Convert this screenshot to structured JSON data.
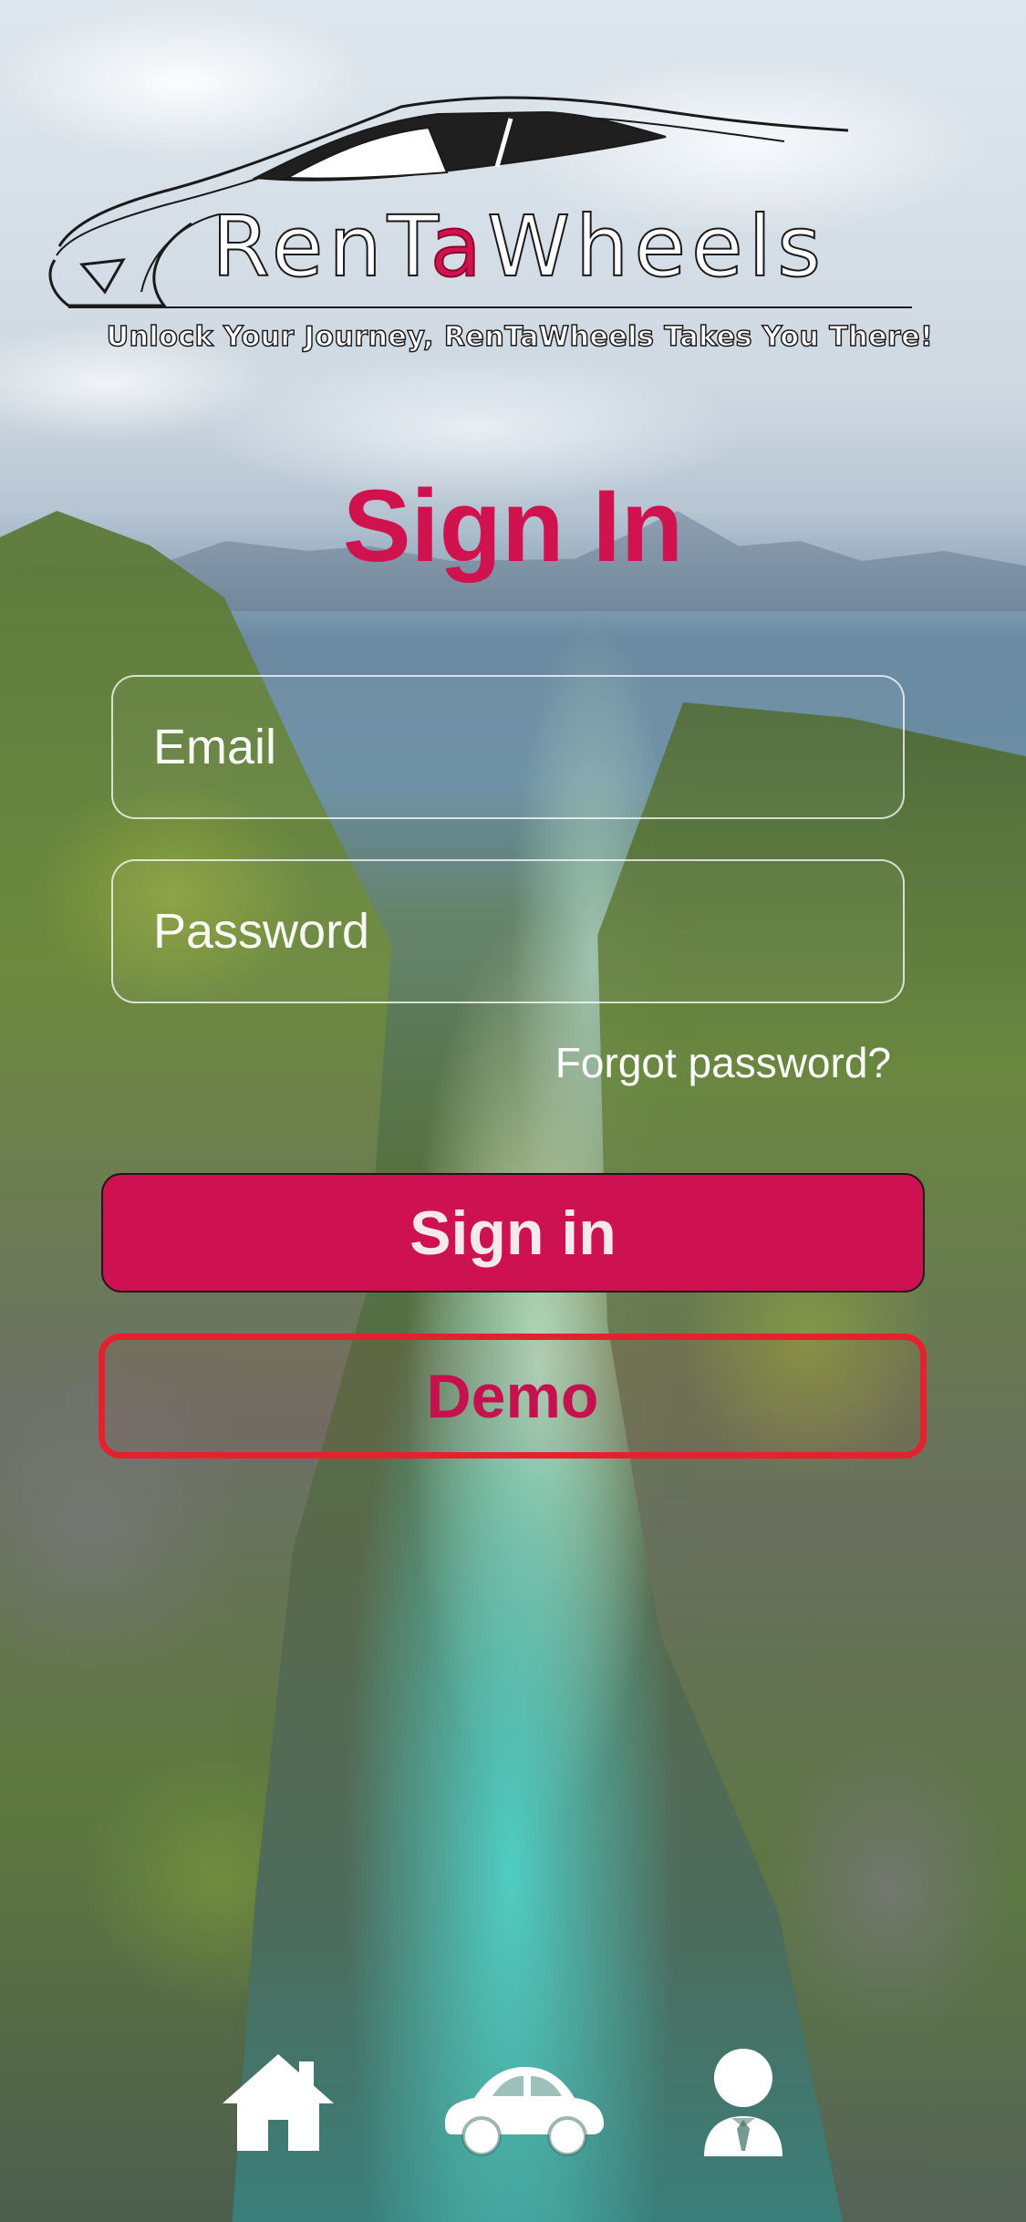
{
  "app": {
    "brand_name_prefix": "RenT",
    "brand_name_accent": "a",
    "brand_name_suffix": "Wheels",
    "tagline": "Unlock Your Journey, RenTaWheels Takes You There!"
  },
  "page": {
    "title": "Sign In"
  },
  "form": {
    "email_placeholder": "Email",
    "email_value": "",
    "password_placeholder": "Password",
    "password_value": "",
    "forgot_label": "Forgot password?",
    "signin_label": "Sign in",
    "demo_label": "Demo"
  },
  "nav": {
    "items": [
      {
        "icon": "home-icon"
      },
      {
        "icon": "car-icon"
      },
      {
        "icon": "user-icon"
      }
    ]
  },
  "colors": {
    "accent": "#ce1150",
    "demo_border": "#e3222e",
    "text_light": "#ffffff"
  }
}
